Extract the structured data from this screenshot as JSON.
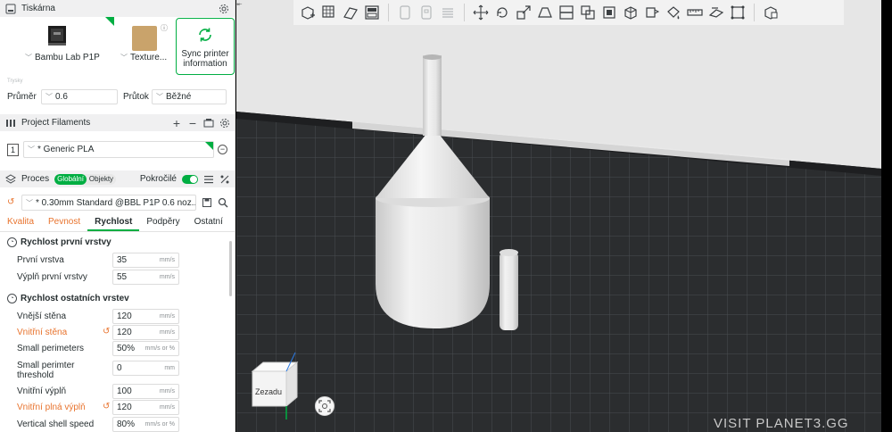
{
  "printer_section": {
    "title": "Tiskárna",
    "printer_name": "Bambu Lab P1P",
    "plate_name": "Texture...",
    "sync_label_line1": "Sync printer",
    "sync_label_line2": "information",
    "nozzle_caption": "Trysky",
    "diameter_label": "Průměr",
    "diameter_value": "0.6",
    "flow_label": "Průtok",
    "flow_value": "Běžné"
  },
  "filaments": {
    "title": "Project Filaments",
    "slot_number": "1",
    "filament_name": "* Generic PLA"
  },
  "process": {
    "title": "Proces",
    "pill_global": "Globální",
    "pill_objects": "Objekty",
    "advanced_label": "Pokročilé",
    "preset_name": "* 0.30mm Standard @BBL P1P 0.6 noz...",
    "tabs": [
      {
        "label": "Kvalita"
      },
      {
        "label": "Pevnost"
      },
      {
        "label": "Rychlost"
      },
      {
        "label": "Podpěry"
      },
      {
        "label": "Ostatní"
      }
    ]
  },
  "settings": {
    "group1_title": "Rychlost první vrstvy",
    "group2_title": "Rychlost ostatních vrstev",
    "rows": [
      {
        "label": "První vrstva",
        "value": "35",
        "unit": "mm/s"
      },
      {
        "label": "Výplň první vrstvy",
        "value": "55",
        "unit": "mm/s"
      },
      {
        "label": "Vnější stěna",
        "value": "120",
        "unit": "mm/s"
      },
      {
        "label": "Vnitřní stěna",
        "value": "120",
        "unit": "mm/s"
      },
      {
        "label": "Small perimeters",
        "value": "50%",
        "unit": "mm/s or %"
      },
      {
        "label": "Small perimter threshold",
        "value": "0",
        "unit": "mm"
      },
      {
        "label": "Vnitřní výplň",
        "value": "100",
        "unit": "mm/s"
      },
      {
        "label": "Vnitřní plná výplň",
        "value": "120",
        "unit": "mm/s"
      },
      {
        "label": "Vertical shell speed",
        "value": "80%",
        "unit": "mm/s or %"
      }
    ]
  },
  "viewport": {
    "view_cube_label": "Zezadu",
    "watermark": "VISIT PLANET3.GG"
  },
  "colors": {
    "accent": "#00ae42",
    "modified": "#e8732d",
    "bed": "#2b2d2f"
  }
}
